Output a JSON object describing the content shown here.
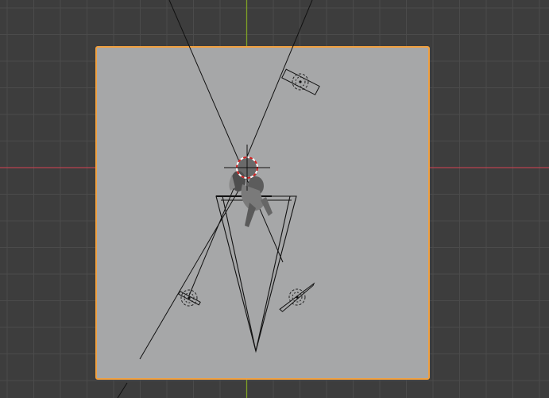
{
  "viewport": {
    "view": "top-orthographic",
    "background_color": "#3d3d3d",
    "grid_line_color": "#4b4b4b",
    "x_axis_color": "#b8434f",
    "y_axis_color": "#7fa026",
    "selection_outline_color": "#f0a040",
    "plane_color": "#a6a7a8"
  },
  "objects": [
    {
      "name": "ground-plane",
      "selected": true
    },
    {
      "name": "figure-mesh",
      "selected": false
    },
    {
      "name": "camera",
      "selected": false
    },
    {
      "name": "area-light-top",
      "selected": false
    },
    {
      "name": "area-light-left",
      "selected": false
    },
    {
      "name": "area-light-right",
      "selected": false
    },
    {
      "name": "3d-cursor",
      "selected": false
    }
  ]
}
